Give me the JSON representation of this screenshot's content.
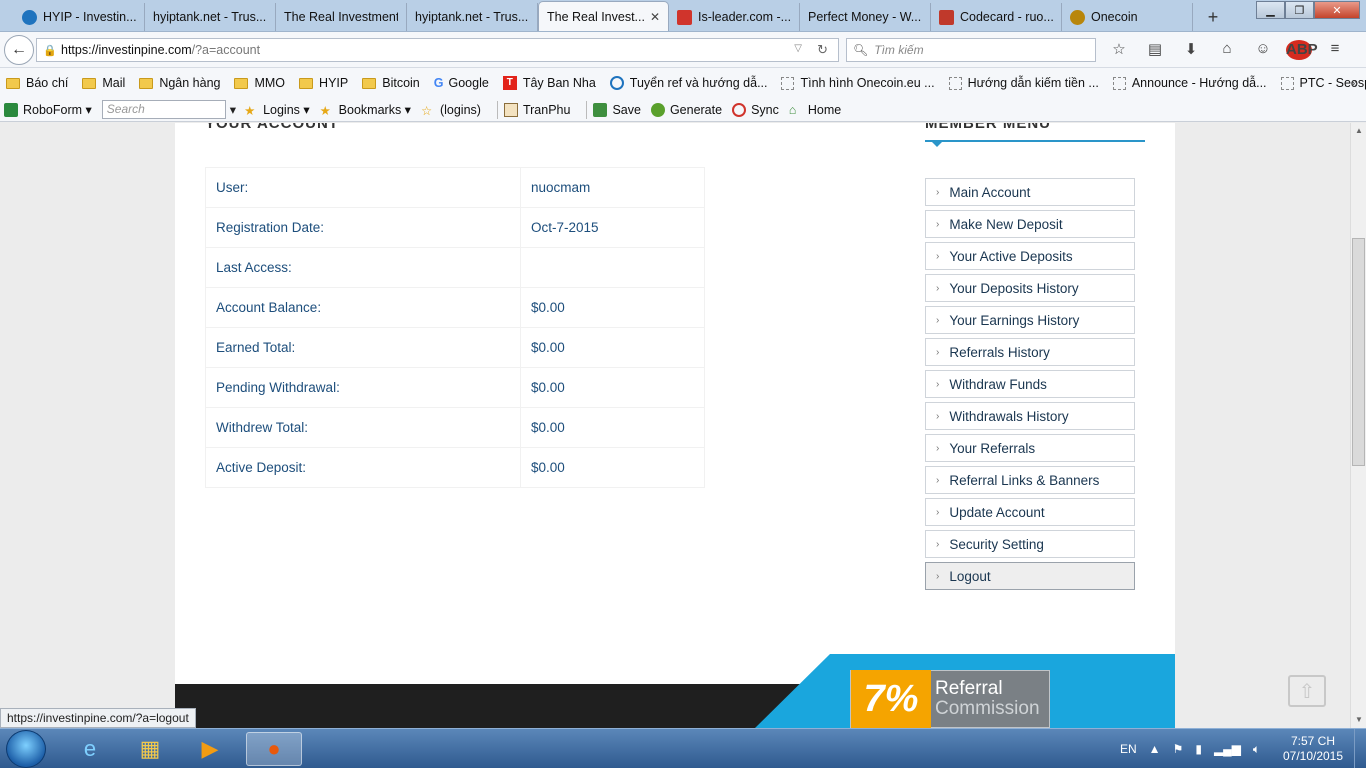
{
  "browser": {
    "tabs": [
      {
        "label": "HYIP - Investin...",
        "icon_color": "#1e73be"
      },
      {
        "label": "hyiptank.net - Trus...",
        "icon_color": ""
      },
      {
        "label": "The Real Investment",
        "icon_color": ""
      },
      {
        "label": "hyiptank.net - Trus...",
        "icon_color": ""
      },
      {
        "label": "The Real Invest...",
        "icon_color": "",
        "active": true
      },
      {
        "label": "Is-leader.com -...",
        "icon_color": "#d0342c"
      },
      {
        "label": "Perfect Money - W...",
        "icon_color": ""
      },
      {
        "label": "Codecard - ruo...",
        "icon_color": "#c0392b"
      },
      {
        "label": "Onecoin",
        "icon_color": "#b8860b"
      }
    ],
    "address": {
      "host": "https://investinpine.com",
      "path": "/?a=account"
    },
    "search_placeholder": "Tìm kiếm",
    "abp_label": "ABP"
  },
  "bookmarks": [
    {
      "label": "Báo chí",
      "type": "folder"
    },
    {
      "label": "Mail",
      "type": "folder"
    },
    {
      "label": "Ngân hàng",
      "type": "folder"
    },
    {
      "label": "MMO",
      "type": "folder"
    },
    {
      "label": "HYIP",
      "type": "folder"
    },
    {
      "label": "Bitcoin",
      "type": "folder"
    },
    {
      "label": "Google",
      "type": "google"
    },
    {
      "label": "Tây Ban Nha",
      "type": "t"
    },
    {
      "label": "Tuyển ref và hướng dẫ...",
      "type": "s"
    },
    {
      "label": "Tình hình Onecoin.eu ...",
      "type": "blank"
    },
    {
      "label": "Hướng dẫn kiếm tiền ...",
      "type": "blank"
    },
    {
      "label": "Announce - Hướng dẫ...",
      "type": "blank"
    },
    {
      "label": "PTC - Seosprint - Hướ...",
      "type": "blank"
    }
  ],
  "roboform": {
    "brand": "RoboForm",
    "search_placeholder": "Search",
    "items": [
      "Logins",
      "Bookmarks",
      "(logins)",
      "TranPhu",
      "Save",
      "Generate",
      "Sync",
      "Home"
    ]
  },
  "page": {
    "section_title": "YOUR ACCOUNT",
    "account_rows": [
      {
        "label": "User:",
        "value": "nuocmam"
      },
      {
        "label": "Registration Date:",
        "value": "Oct-7-2015"
      },
      {
        "label": "Last Access:",
        "value": ""
      },
      {
        "label": "Account Balance:",
        "value": "$0.00"
      },
      {
        "label": "Earned Total:",
        "value": "$0.00"
      },
      {
        "label": "Pending Withdrawal:",
        "value": "$0.00"
      },
      {
        "label": "Withdrew Total:",
        "value": "$0.00"
      },
      {
        "label": "Active Deposit:",
        "value": "$0.00"
      }
    ],
    "menu_title": "MEMBER MENU",
    "menu": [
      "Main Account",
      "Make New Deposit",
      "Your Active Deposits",
      "Your Deposits History",
      "Your Earnings History",
      "Referrals History",
      "Withdraw Funds",
      "Withdrawals History",
      "Your Referrals",
      "Referral Links & Banners",
      "Update Account",
      "Security Setting",
      "Logout"
    ],
    "promo": {
      "percent": "7%",
      "line1": "Referral",
      "line2": "Commission"
    },
    "status_url": "https://investinpine.com/?a=logout"
  },
  "taskbar": {
    "lang": "EN",
    "time": "7:57 CH",
    "date": "07/10/2015"
  },
  "colors": {
    "accent": "#2a95c9",
    "link": "#1d4e7c",
    "promo_orange": "#f5a400",
    "footer_blue": "#1aa6dd"
  }
}
